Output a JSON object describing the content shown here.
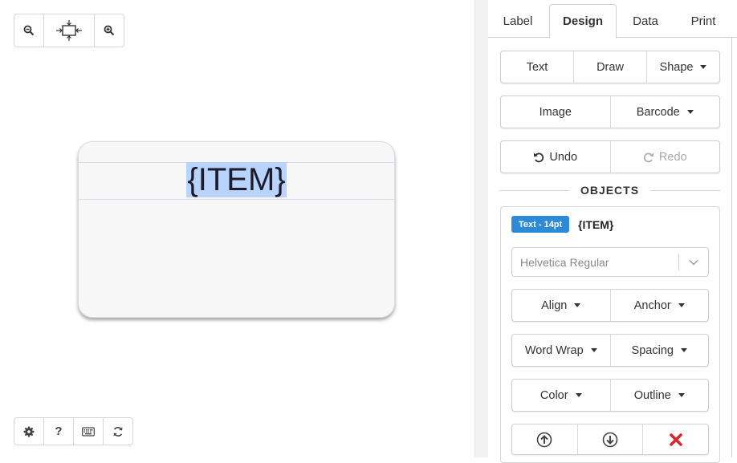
{
  "canvas": {
    "zoom_tools": [
      "zoom-out",
      "fit-to-window",
      "zoom-in"
    ],
    "label_text": "{ITEM}",
    "bottom_tools": [
      "settings",
      "help",
      "keyboard",
      "refresh"
    ],
    "help_glyph": "?"
  },
  "tabs": [
    {
      "label": "Label"
    },
    {
      "label": "Design"
    },
    {
      "label": "Data"
    },
    {
      "label": "Print"
    }
  ],
  "active_tab": "Design",
  "design": {
    "insert": {
      "text": "Text",
      "draw": "Draw",
      "shape": "Shape"
    },
    "media": {
      "image": "Image",
      "barcode": "Barcode"
    },
    "history": {
      "undo": "Undo",
      "redo": "Redo"
    },
    "objects_heading": "OBJECTS"
  },
  "object": {
    "badge": "Text - 14pt",
    "name": "{ITEM}",
    "font": "Helvetica Regular",
    "buttons": {
      "align": "Align",
      "anchor": "Anchor",
      "word_wrap": "Word Wrap",
      "spacing": "Spacing",
      "color": "Color",
      "outline": "Outline"
    },
    "actions": [
      "bring-forward",
      "send-backward",
      "delete"
    ]
  },
  "colors": {
    "accent": "#2d8ad6",
    "selection": "#b9d4fb",
    "delete": "#d9262b"
  }
}
